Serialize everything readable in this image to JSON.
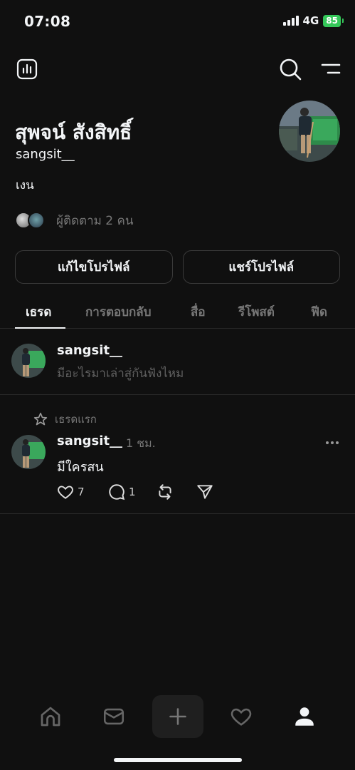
{
  "status": {
    "time": "07:08",
    "network": "4G",
    "battery": "85"
  },
  "top_bar": {
    "insights_icon": "bar-chart-icon",
    "search_icon": "search-icon",
    "menu_icon": "menu-icon"
  },
  "profile": {
    "name": "สุพจน์ สังสิทธิ์",
    "handle": "sangsit__",
    "bio": "เงน",
    "followers_text": "ผู้ติดตาม 2 คน",
    "edit_label": "แก้ไขโปรไฟล์",
    "share_label": "แชร์โปรไฟล์"
  },
  "tabs": [
    {
      "label": "เธรด",
      "active": true
    },
    {
      "label": "การตอบกลับ",
      "active": false
    },
    {
      "label": "สื่อ",
      "active": false
    },
    {
      "label": "รีโพสต์",
      "active": false
    },
    {
      "label": "ฟีด",
      "active": false
    }
  ],
  "composer": {
    "name": "sangsit__",
    "placeholder": "มีอะไรมาเล่าสู่กันฟังไหม"
  },
  "post": {
    "pinned_label": "เธรดแรก",
    "author": "sangsit__",
    "time": "1 ชม.",
    "text": "มีใครสน",
    "likes": "7",
    "replies": "1"
  },
  "bottom_nav": [
    "home-icon",
    "inbox-icon",
    "create-icon",
    "activity-heart-icon",
    "profile-icon"
  ],
  "colors": {
    "background": "#101010",
    "text": "#f3f5f7",
    "muted": "#777777",
    "battery": "#34c759"
  }
}
